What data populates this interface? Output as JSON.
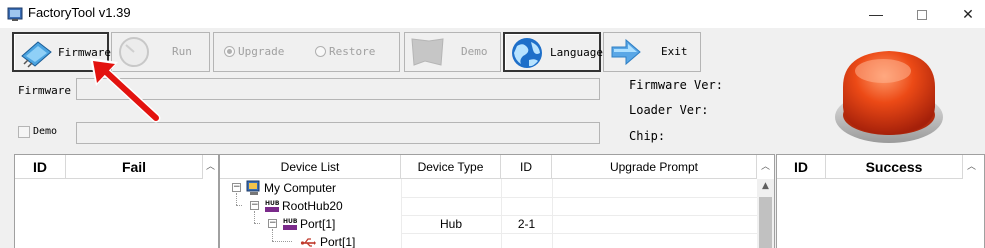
{
  "window": {
    "title": "FactoryTool v1.39",
    "minimize_glyph": "—",
    "close_glyph": "✕"
  },
  "toolbar": {
    "firmware_label": "Firmware",
    "run_label": "Run",
    "upgrade_label": "Upgrade",
    "restore_label": "Restore",
    "demo_label": "Demo",
    "language_label": "Language",
    "exit_label": "Exit",
    "upgrade_selected": true
  },
  "form": {
    "firmware_label": "Firmware",
    "firmware_value": "",
    "demo_label": "Demo",
    "demo_value": "",
    "demo_checked": false
  },
  "info": {
    "firmware_ver_label": "Firmware Ver:",
    "loader_ver_label": "Loader Ver:",
    "chip_label": "Chip:"
  },
  "fail_table": {
    "headers": [
      "ID",
      "Fail"
    ]
  },
  "success_table": {
    "headers": [
      "ID",
      "Success"
    ]
  },
  "device_table": {
    "headers": [
      "Device List",
      "Device Type",
      "ID",
      "Upgrade Prompt"
    ],
    "rows": [
      {
        "name": "My Computer",
        "type": "",
        "id": "",
        "prompt": "",
        "icon": "computer-icon",
        "badge": ""
      },
      {
        "name": "RootHub20",
        "type": "",
        "id": "",
        "prompt": "",
        "icon": "hub-icon",
        "badge": "HUB"
      },
      {
        "name": "Port[1]",
        "type": "Hub",
        "id": "2-1",
        "prompt": "",
        "icon": "hub-icon",
        "badge": "HUB"
      },
      {
        "name": "Port[1]",
        "type": "",
        "id": "",
        "prompt": "",
        "icon": "usb-icon",
        "badge": ""
      }
    ]
  },
  "colors": {
    "button_red": "#e8481c",
    "arrow_red": "#e3130f",
    "language_blue": "#1e6fc9",
    "exit_blue": "#5aa7e6"
  }
}
